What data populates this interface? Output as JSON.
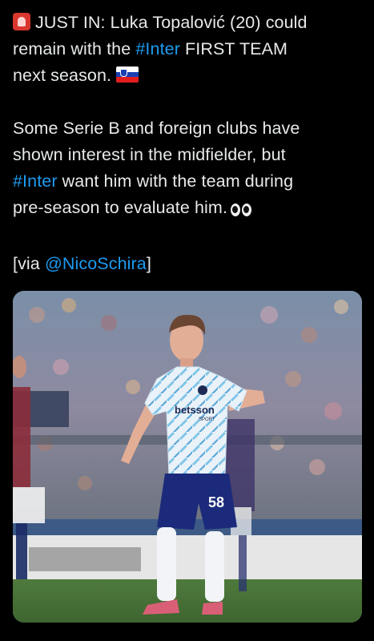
{
  "tweet": {
    "line1_prefix": "JUST IN: Luka Topalović (20) could",
    "line2_before": "remain with the ",
    "line2_hashtag": "#Inter",
    "line2_after": " FIRST TEAM",
    "line3": "next season.",
    "line4": "Some Serie B and foreign clubs have",
    "line5": "shown interest in the midfielder, but",
    "line6_hashtag": "#Inter",
    "line6_after": " want him with the team during",
    "line7": "pre-season to evaluate him.",
    "line8_before": "[via ",
    "line8_mention": "@NicoSchira",
    "line8_after": "]"
  },
  "icons": {
    "siren": "police-car-light-icon",
    "flag": "slovenia-flag-icon",
    "eyes": "eyes-icon"
  },
  "photo": {
    "sponsor_text": "betsson",
    "sponsor_sub": "SPORT",
    "shirt_number": "58"
  },
  "colors": {
    "background": "#000000",
    "text": "#e7e9ea",
    "link": "#1d9bf0"
  }
}
